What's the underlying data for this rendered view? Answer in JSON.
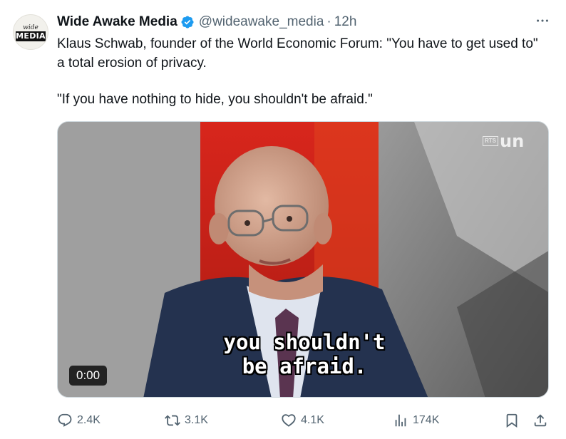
{
  "author": {
    "avatar_top": "wide awake",
    "avatar_bottom": "MEDIA",
    "display_name": "Wide Awake Media",
    "verified": true,
    "handle": "@wideawake_media",
    "separator": "·",
    "time": "12h"
  },
  "tweet": {
    "paragraph_1": "Klaus Schwab, founder of the World Economic Forum: \"You have to get used to\" a total erosion of privacy.",
    "paragraph_2": "\"If you have nothing to hide, you shouldn't be afraid.\""
  },
  "video": {
    "caption_line_1": "you shouldn't",
    "caption_line_2": "be afraid.",
    "channel_badge": "RTS",
    "channel_name": "un",
    "duration": "0:00"
  },
  "actions": {
    "replies": "2.4K",
    "reposts": "3.1K",
    "likes": "4.1K",
    "views": "174K"
  },
  "icons": {
    "more": "more-horizontal-icon",
    "verified": "verified-badge-icon",
    "reply": "reply-icon",
    "repost": "repost-icon",
    "like": "heart-icon",
    "views": "views-chart-icon",
    "bookmark": "bookmark-icon",
    "share": "share-icon"
  },
  "colors": {
    "verified_blue": "#1d9bf0",
    "muted_text": "#536471",
    "primary_text": "#0f1419"
  }
}
